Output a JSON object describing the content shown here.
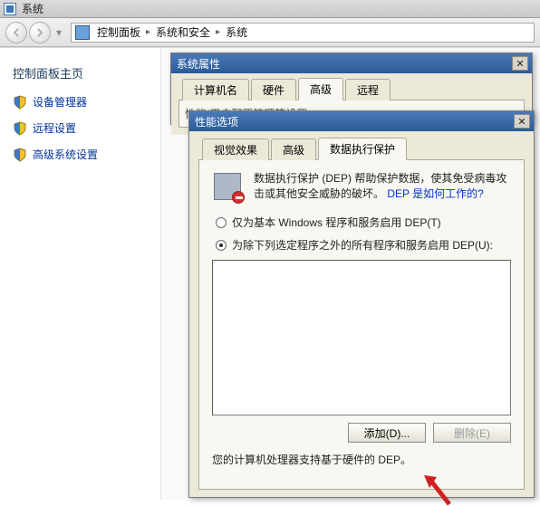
{
  "main_window": {
    "title": "系统",
    "breadcrumb": {
      "root": "控制面板",
      "mid": "系统和安全",
      "leaf": "系统"
    }
  },
  "sidebar": {
    "title": "控制面板主页",
    "items": [
      {
        "label": "设备管理器"
      },
      {
        "label": "远程设置"
      },
      {
        "label": "高级系统设置"
      }
    ]
  },
  "sysprop_dialog": {
    "title": "系统属性",
    "tabs": {
      "computer_name": "计算机名",
      "hardware": "硬件",
      "advanced": "高级",
      "remote": "远程"
    },
    "partial_text": "性能/用户配置管理等设置"
  },
  "perf_dialog": {
    "title": "性能选项",
    "tabs": {
      "visual": "视觉效果",
      "advanced": "高级",
      "dep": "数据执行保护"
    },
    "dep": {
      "description_1": "数据执行保护 (DEP) 帮助保护数据，使其免受病毒攻击或其他安全威胁的破坏。",
      "link_text": "DEP 是如何工作的?",
      "radio_essential": "仅为基本 Windows 程序和服务启用 DEP(T)",
      "radio_all_except": "为除下列选定程序之外的所有程序和服务启用 DEP(U):",
      "add_btn": "添加(D)...",
      "remove_btn": "删除(E)",
      "footer": "您的计算机处理器支持基于硬件的 DEP。"
    }
  }
}
